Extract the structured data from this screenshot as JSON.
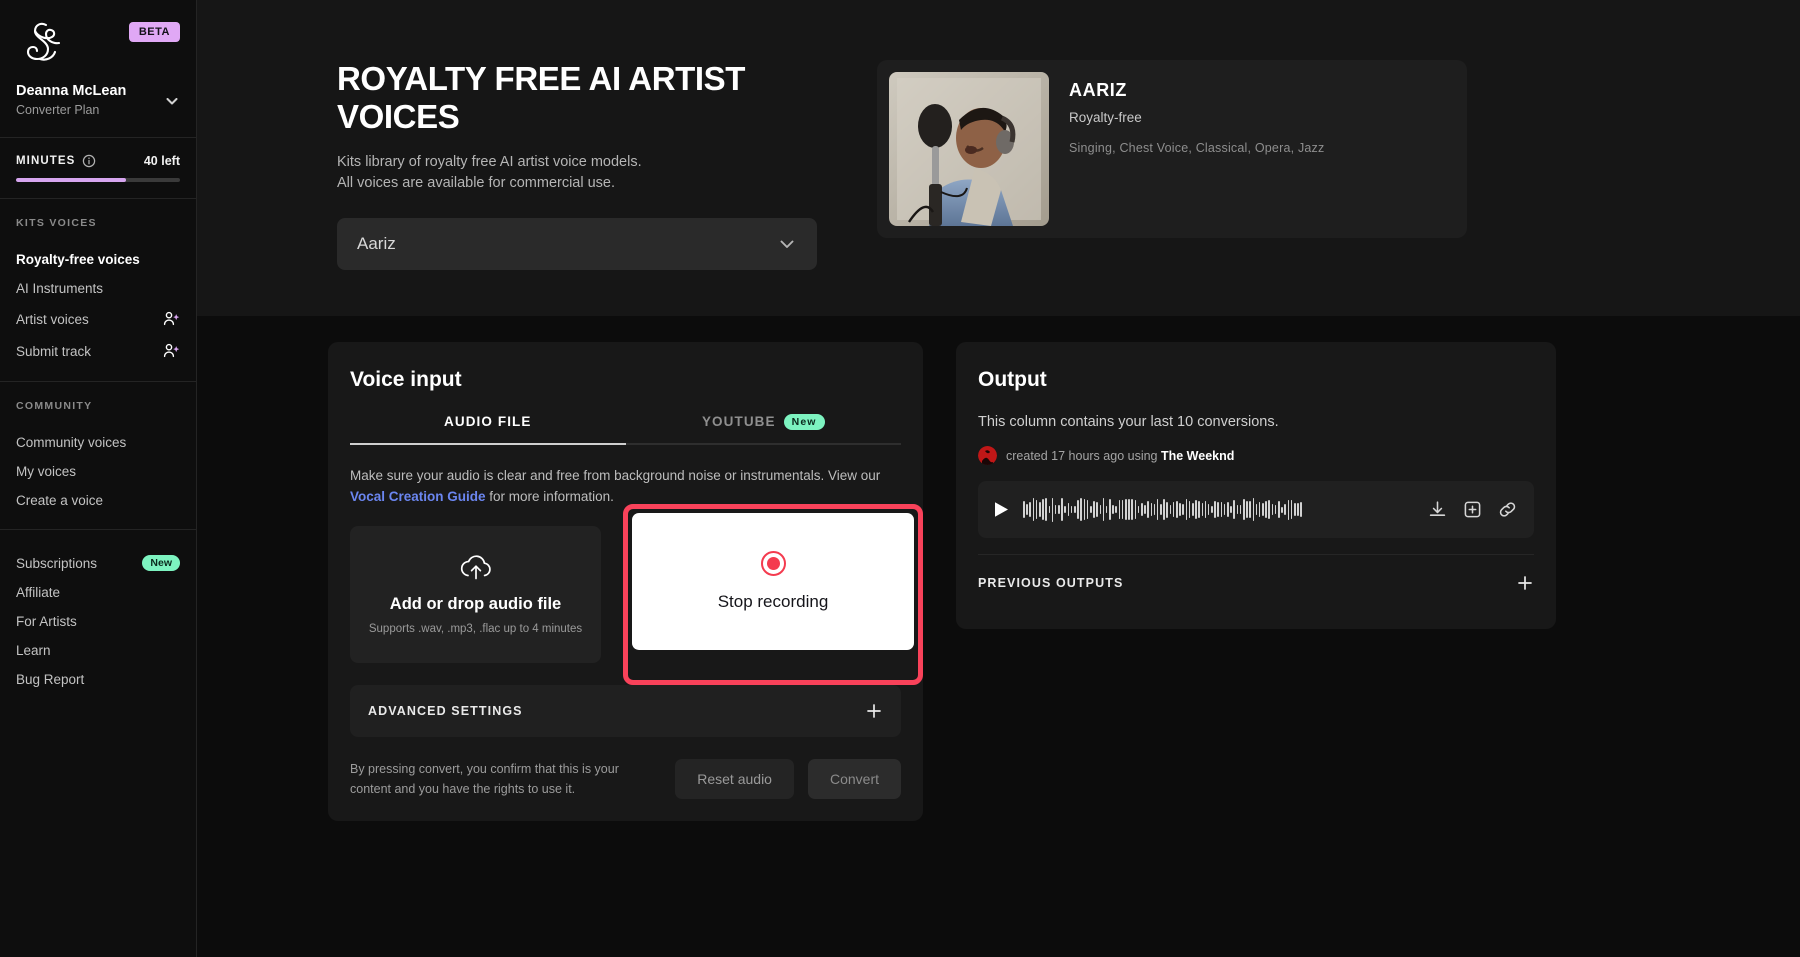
{
  "sidebar": {
    "logo_icon": "kits-ampersand-logo",
    "beta_badge": "BETA",
    "user_name": "Deanna McLean",
    "user_plan": "Converter Plan",
    "chevron_icon": "chevron-down-icon",
    "minutes": {
      "label": "MINUTES",
      "info_icon": "info-icon",
      "remaining": "40 left",
      "progress_percent": 67,
      "bar_color": "#d6a5ef"
    },
    "sections": [
      {
        "heading": "KITS VOICES",
        "items": [
          {
            "label": "Royalty-free voices",
            "active": true,
            "badge": "",
            "icon": ""
          },
          {
            "label": "AI Instruments",
            "active": false,
            "badge": "",
            "icon": ""
          },
          {
            "label": "Artist voices",
            "active": false,
            "badge": "",
            "icon": "person-sparkle-icon"
          },
          {
            "label": "Submit track",
            "active": false,
            "badge": "",
            "icon": "person-sparkle-icon"
          }
        ]
      },
      {
        "heading": "COMMUNITY",
        "items": [
          {
            "label": "Community voices",
            "active": false,
            "badge": "",
            "icon": ""
          },
          {
            "label": "My voices",
            "active": false,
            "badge": "",
            "icon": ""
          },
          {
            "label": "Create a voice",
            "active": false,
            "badge": "",
            "icon": ""
          }
        ]
      },
      {
        "heading": "",
        "items": [
          {
            "label": "Subscriptions",
            "active": false,
            "badge": "New",
            "icon": ""
          },
          {
            "label": "Affiliate",
            "active": false,
            "badge": "",
            "icon": ""
          },
          {
            "label": "For Artists",
            "active": false,
            "badge": "",
            "icon": ""
          },
          {
            "label": "Learn",
            "active": false,
            "badge": "",
            "icon": ""
          },
          {
            "label": "Bug Report",
            "active": false,
            "badge": "",
            "icon": ""
          }
        ]
      }
    ]
  },
  "hero": {
    "title": "ROYALTY FREE AI ARTIST VOICES",
    "subtitle_line1": "Kits library of royalty free AI artist voice models.",
    "subtitle_line2": "All voices are available for commercial use.",
    "voice_select_value": "Aariz",
    "voice_select_chevron_icon": "chevron-down-icon",
    "voice_card": {
      "thumbnail_icon": "singer-photo",
      "name": "AARIZ",
      "type": "Royalty-free",
      "tags": "Singing, Chest Voice, Classical, Opera, Jazz"
    }
  },
  "voice_input": {
    "title": "Voice input",
    "tabs": [
      {
        "label": "AUDIO FILE",
        "active": true,
        "badge": ""
      },
      {
        "label": "YOUTUBE",
        "active": false,
        "badge": "New"
      }
    ],
    "help_text_1": "Make sure your audio is clear and free from background noise or instrumentals. View our",
    "help_link": "Vocal Creation Guide",
    "help_text_2": "for more information.",
    "drop_zone": {
      "icon": "cloud-upload-icon",
      "title": "Add or drop audio file",
      "subtitle": "Supports .wav, .mp3, .flac up to 4 minutes"
    },
    "record_button": {
      "icon": "record-stop-icon",
      "label": "Stop recording",
      "highlight_color": "#f9425a"
    },
    "advanced_settings": {
      "label": "ADVANCED SETTINGS",
      "expand_icon": "plus-icon"
    },
    "footer_note": "By pressing convert, you confirm that this is your content and you have the rights to use it.",
    "reset_label": "Reset audio",
    "convert_label": "Convert"
  },
  "output": {
    "title": "Output",
    "subtitle": "This column contains your last 10 conversions.",
    "entry": {
      "avatar_icon": "artist-avatar",
      "meta_prefix": "created 17 hours ago using",
      "model_name": "The Weeknd"
    },
    "player": {
      "play_icon": "play-icon",
      "download_icon": "download-icon",
      "save-to-library_icon": "add-to-collection-icon",
      "link_icon": "link-icon"
    },
    "previous_outputs": {
      "label": "PREVIOUS OUTPUTS",
      "expand_icon": "plus-icon"
    }
  }
}
